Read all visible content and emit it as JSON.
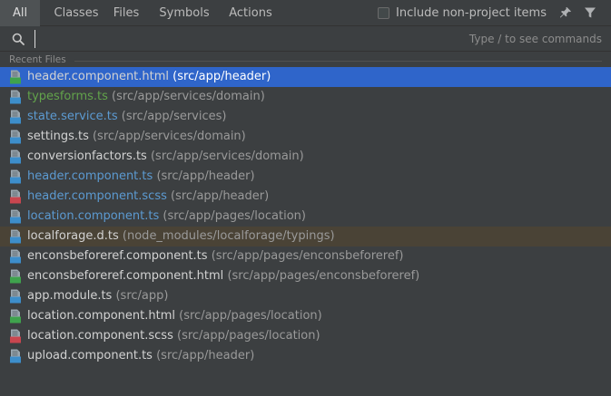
{
  "tabs": [
    {
      "label": "All"
    },
    {
      "label": "Classes"
    },
    {
      "label": "Files"
    },
    {
      "label": "Symbols"
    },
    {
      "label": "Actions"
    }
  ],
  "active_tab": "All",
  "non_project": {
    "label": "Include non-project items",
    "checked": false
  },
  "icons": {
    "pin": "pin-icon",
    "filter": "filter-icon",
    "search": "search-icon"
  },
  "search": {
    "value": "",
    "hint": "Type / to see commands"
  },
  "recent": {
    "label": "Recent Files",
    "items": [
      {
        "name": "header.component.html",
        "path": "(src/app/header)",
        "type": "html",
        "color": "default",
        "selected": true
      },
      {
        "name": "typesforms.ts",
        "path": "(src/app/services/domain)",
        "type": "ts",
        "color": "green"
      },
      {
        "name": "state.service.ts",
        "path": "(src/app/services)",
        "type": "ts",
        "color": "blue"
      },
      {
        "name": "settings.ts",
        "path": "(src/app/services/domain)",
        "type": "ts",
        "color": "default"
      },
      {
        "name": "conversionfactors.ts",
        "path": "(src/app/services/domain)",
        "type": "ts",
        "color": "default"
      },
      {
        "name": "header.component.ts",
        "path": "(src/app/header)",
        "type": "ts",
        "color": "blue"
      },
      {
        "name": "header.component.scss",
        "path": "(src/app/header)",
        "type": "sass",
        "color": "blue"
      },
      {
        "name": "location.component.ts",
        "path": "(src/app/pages/location)",
        "type": "ts",
        "color": "blue"
      },
      {
        "name": "localforage.d.ts",
        "path": "(node_modules/localforage/typings)",
        "type": "ts",
        "color": "default",
        "non_project": true
      },
      {
        "name": "enconsbeforeref.component.ts",
        "path": "(src/app/pages/enconsbeforeref)",
        "type": "ts",
        "color": "default"
      },
      {
        "name": "enconsbeforeref.component.html",
        "path": "(src/app/pages/enconsbeforeref)",
        "type": "html",
        "color": "default"
      },
      {
        "name": "app.module.ts",
        "path": "(src/app)",
        "type": "ts",
        "color": "default"
      },
      {
        "name": "location.component.html",
        "path": "(src/app/pages/location)",
        "type": "html",
        "color": "default"
      },
      {
        "name": "location.component.scss",
        "path": "(src/app/pages/location)",
        "type": "sass",
        "color": "default"
      },
      {
        "name": "upload.component.ts",
        "path": "(src/app/header)",
        "type": "ts",
        "color": "default"
      }
    ]
  },
  "colors": {
    "selection": "#2f65ca",
    "non_project_bg": "#4a4336",
    "green": "#62a34b",
    "blue": "#5c9ad1",
    "ts_badge": "#3d8ecb",
    "html_badge": "#3fa34d",
    "sass_badge": "#c9464f"
  }
}
